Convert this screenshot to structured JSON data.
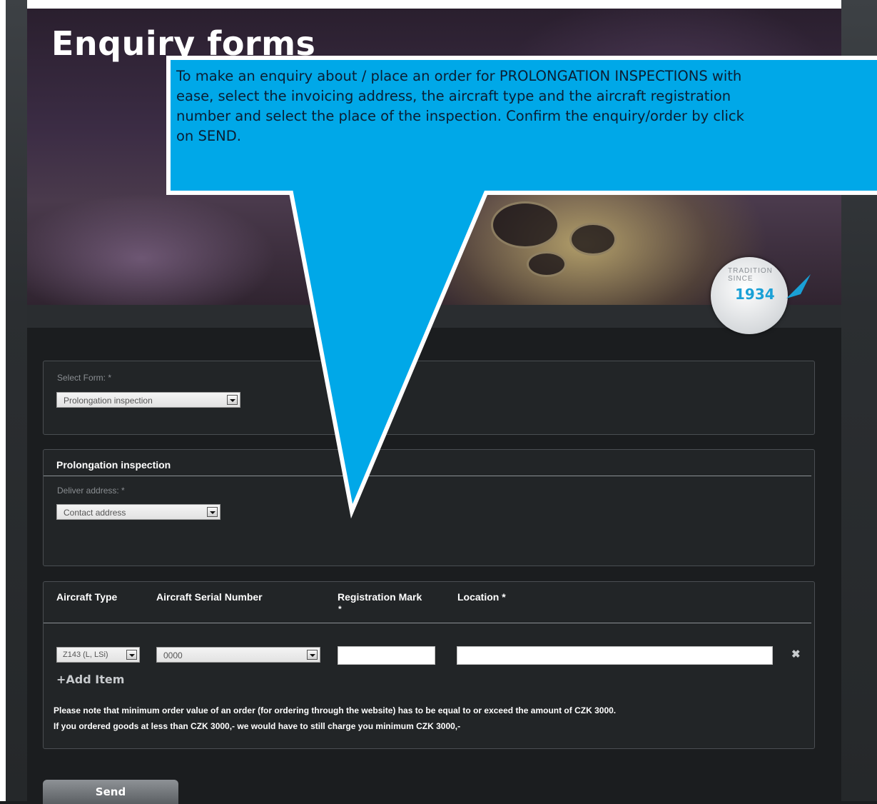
{
  "hero": {
    "title": "Enquiry forms",
    "badge_text": "TRADITION SINCE",
    "badge_year": "1934"
  },
  "callout": {
    "lines": [
      "To make an enquiry about / place an order for PROLONGATION INSPECTIONS with",
      "ease, select the invoicing address, the aircraft type and the aircraft registration",
      "number and select the place of the inspection. Confirm the enquiry/order by click",
      "on SEND."
    ],
    "color": "#00a8e8"
  },
  "select_form": {
    "label": "Select Form: *",
    "value": "Prolongation inspection"
  },
  "prolongation": {
    "heading": "Prolongation inspection",
    "deliver_label": "Deliver address: *",
    "deliver_value": "Contact address"
  },
  "items": {
    "columns": {
      "aircraft_type": "Aircraft Type",
      "serial_number": "Aircraft Serial Number",
      "registration_mark": "Registration Mark",
      "registration_required": "*",
      "location": "Location *"
    },
    "row": {
      "aircraft_type": "Z143 (L, LSi)",
      "serial_number": "0000",
      "registration_mark": "",
      "location": ""
    },
    "remove_icon": "✖",
    "add_item": "Add Item",
    "add_icon": "+",
    "notes": [
      "Please note that minimum order value of an order (for ordering through the website) has to be equal to or exceed the amount of CZK 3000.",
      "If you ordered goods at less than CZK 3000,- we would have to still charge you minimum CZK 3000,-"
    ]
  },
  "send_label": "Send"
}
